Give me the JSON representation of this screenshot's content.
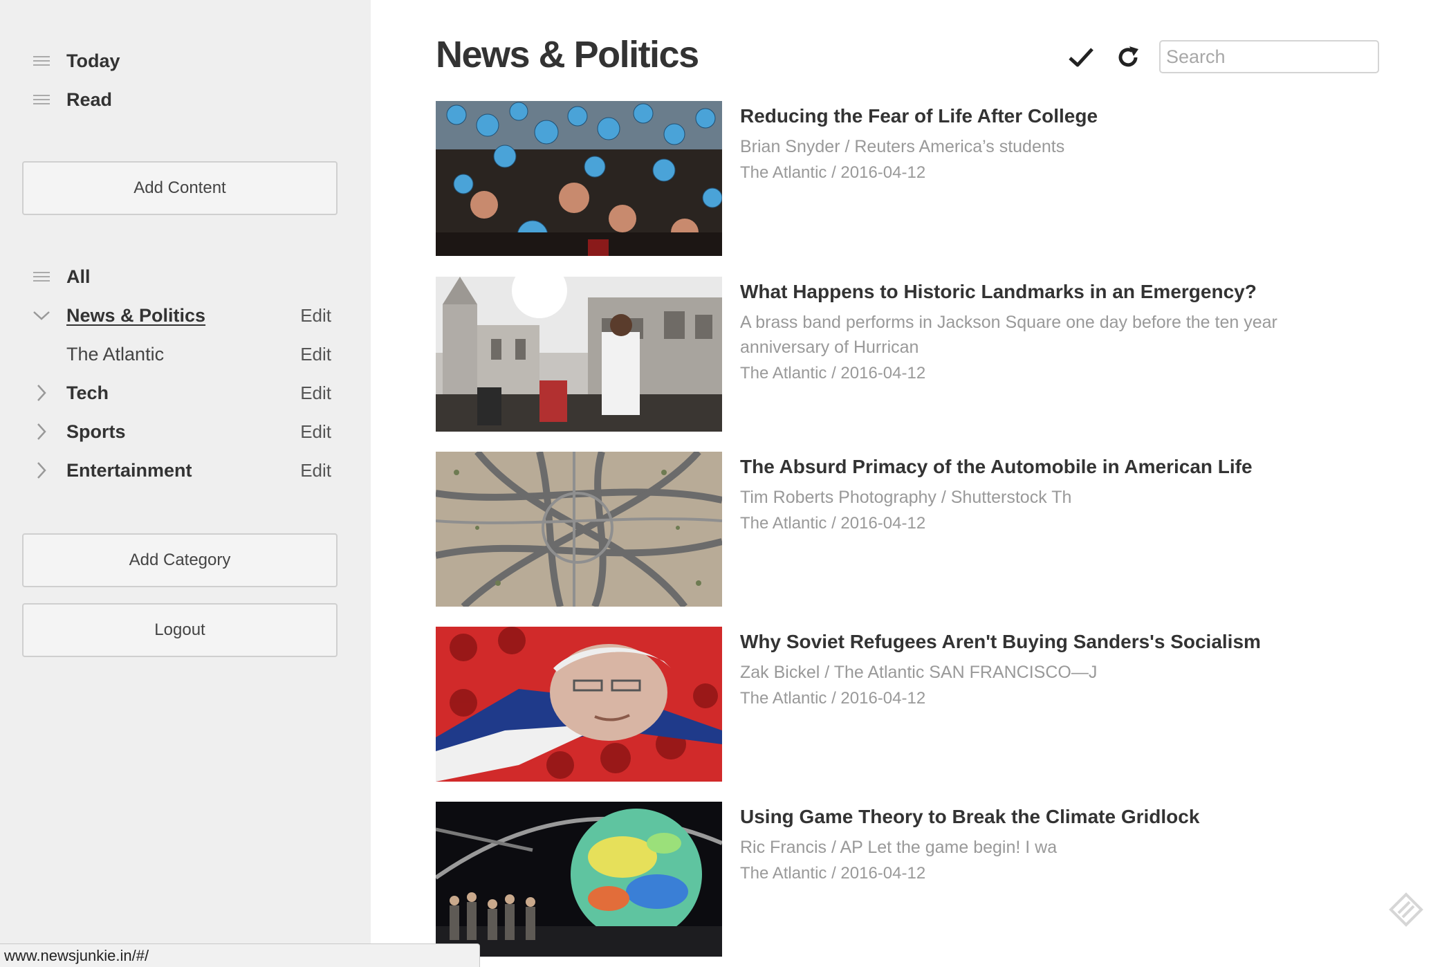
{
  "sidebar": {
    "top_nav": [
      {
        "label": "Today",
        "icon": "menu-icon"
      },
      {
        "label": "Read",
        "icon": "menu-icon"
      }
    ],
    "add_content_label": "Add Content",
    "all_label": "All",
    "categories": [
      {
        "label": "News & Politics",
        "edit": "Edit",
        "state": "expanded",
        "icon": "chevron-down-icon"
      },
      {
        "label": "The Atlantic",
        "edit": "Edit",
        "state": "child"
      },
      {
        "label": "Tech",
        "edit": "Edit",
        "state": "collapsed",
        "icon": "chevron-right-icon"
      },
      {
        "label": "Sports",
        "edit": "Edit",
        "state": "collapsed",
        "icon": "chevron-right-icon"
      },
      {
        "label": "Entertainment",
        "edit": "Edit",
        "state": "collapsed",
        "icon": "chevron-right-icon"
      }
    ],
    "add_category_label": "Add Category",
    "logout_label": "Logout"
  },
  "header": {
    "title": "News & Politics",
    "mark_read_icon": "checkmark-icon",
    "refresh_icon": "refresh-icon",
    "search_placeholder": "Search"
  },
  "articles": [
    {
      "title": "Reducing the Fear of Life After College",
      "summary": "Brian Snyder / Reuters America’s students",
      "meta": "The Atlantic / 2016-04-12",
      "image": "graduates holding globe balloons"
    },
    {
      "title": "What Happens to Historic Landmarks in an Emergency?",
      "summary": "A brass band performs in Jackson Square one day before the ten year anniversary of Hurrican",
      "meta": "The Atlantic / 2016-04-12",
      "image": "brass band in front of cathedral"
    },
    {
      "title": "The Absurd Primacy of the Automobile in American Life",
      "summary": "Tim Roberts Photography / Shutterstock Th",
      "meta": "The Atlantic / 2016-04-12",
      "image": "aerial highway interchange"
    },
    {
      "title": "Why Soviet Refugees Aren't Buying Sanders's Socialism",
      "summary": "Zak Bickel / The Atlantic SAN FRANCISCO—J",
      "meta": "The Atlantic / 2016-04-12",
      "image": "collage with red posters and flag"
    },
    {
      "title": "Using Game Theory to Break the Climate Gridlock",
      "summary": "Ric Francis / AP Let the game begin! I wa",
      "meta": "The Atlantic / 2016-04-12",
      "image": "illuminated globe above crowd"
    }
  ],
  "status_bar": {
    "url": "www.newsjunkie.in/#/"
  },
  "floating_icon": "feedback-icon",
  "colors": {
    "sidebar_bg": "#efefef",
    "title_text": "#333333",
    "muted_text": "#999999",
    "border": "#cfcfcf"
  }
}
